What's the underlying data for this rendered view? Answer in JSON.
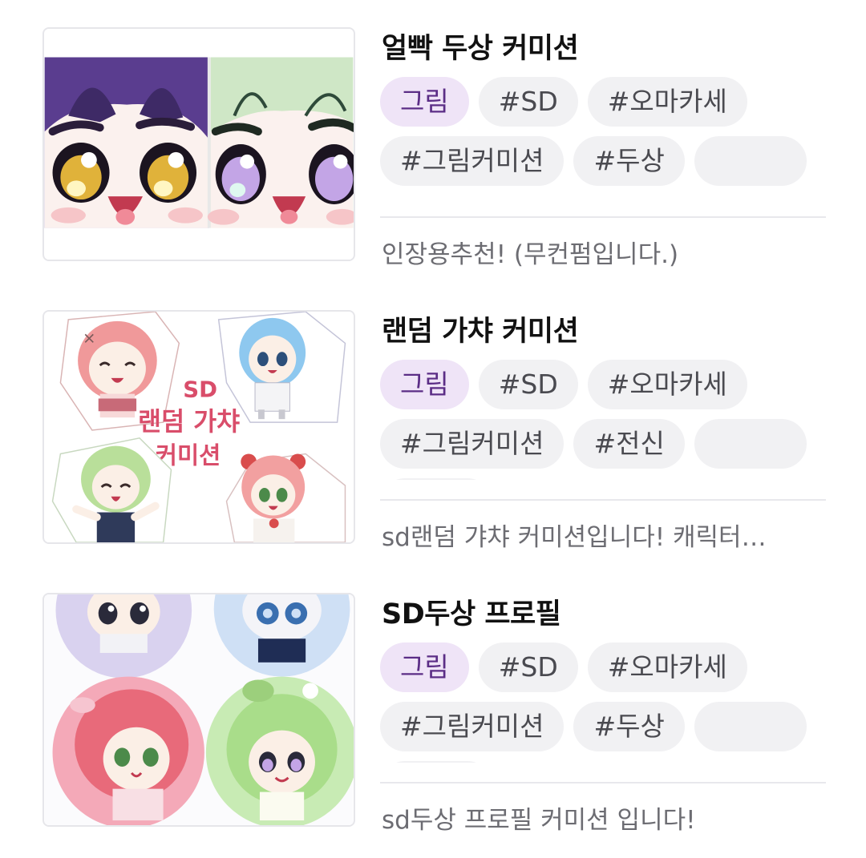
{
  "items": [
    {
      "title": "얼빡 두상 커미션",
      "tags": [
        "그림",
        "#SD",
        "#오마카세",
        "#그림커미션",
        "#두상"
      ],
      "description": "인장용추천! (무컨펌입니다.)"
    },
    {
      "title": "랜덤 가챠 커미션",
      "tags": [
        "그림",
        "#SD",
        "#오마카세",
        "#그림커미션",
        "#전신"
      ],
      "description": "sd랜덤 갸챠 커미션입니다! 캐릭터…",
      "thumb_text": [
        "SD",
        "랜덤 가챠",
        "커미션"
      ]
    },
    {
      "title": "SD두상 프로필",
      "tags": [
        "그림",
        "#SD",
        "#오마카세",
        "#그림커미션",
        "#두상"
      ],
      "description": "sd두상 프로필 커미션 입니다!"
    }
  ],
  "colors": {
    "primary_tag_bg": "#efe4f7",
    "primary_tag_text": "#5b2d86",
    "tag_bg": "#f1f1f3",
    "tag_text": "#4a4a50",
    "title_text": "#111111",
    "desc_text": "#6c6c72"
  }
}
